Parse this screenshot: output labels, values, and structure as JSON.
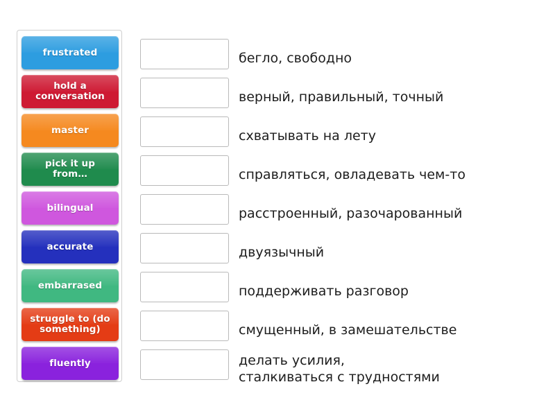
{
  "exercise": {
    "type": "drag-and-drop-matching",
    "tiles": [
      {
        "label": "frustrated",
        "color": "#2d9de0"
      },
      {
        "label": "hold a\nconversation",
        "color": "#ce1a33"
      },
      {
        "label": "master",
        "color": "#f5891f"
      },
      {
        "label": "pick it up\nfrom…",
        "color": "#1f8b4d"
      },
      {
        "label": "bilingual",
        "color": "#cf57de"
      },
      {
        "label": "accurate",
        "color": "#2430bd"
      },
      {
        "label": "embarrased",
        "color": "#40b881"
      },
      {
        "label": "struggle to (do\nsomething)",
        "color": "#e43c15"
      },
      {
        "label": "fluently",
        "color": "#8a22dd"
      }
    ],
    "rows": [
      {
        "dropbox_value": "",
        "definition": "бегло, свободно"
      },
      {
        "dropbox_value": "",
        "definition": "верный, правильный, точный"
      },
      {
        "dropbox_value": "",
        "definition": "схватывать на лету"
      },
      {
        "dropbox_value": "",
        "definition": "справляться, овладевать чем-то"
      },
      {
        "dropbox_value": "",
        "definition": "расстроенный, разочарованный"
      },
      {
        "dropbox_value": "",
        "definition": "двуязычный"
      },
      {
        "dropbox_value": "",
        "definition": "поддерживать разговор"
      },
      {
        "dropbox_value": "",
        "definition": "смущенный, в замешательстве"
      },
      {
        "dropbox_value": "",
        "definition": "делать усилия,\nсталкиваться с трудностями"
      }
    ]
  },
  "colors": {
    "page_background": "#ffffff",
    "panel_border": "#cfcfcf",
    "dropbox_border": "#b9b9b9",
    "definition_text": "#1d1d1d",
    "tile_text": "#ffffff"
  }
}
